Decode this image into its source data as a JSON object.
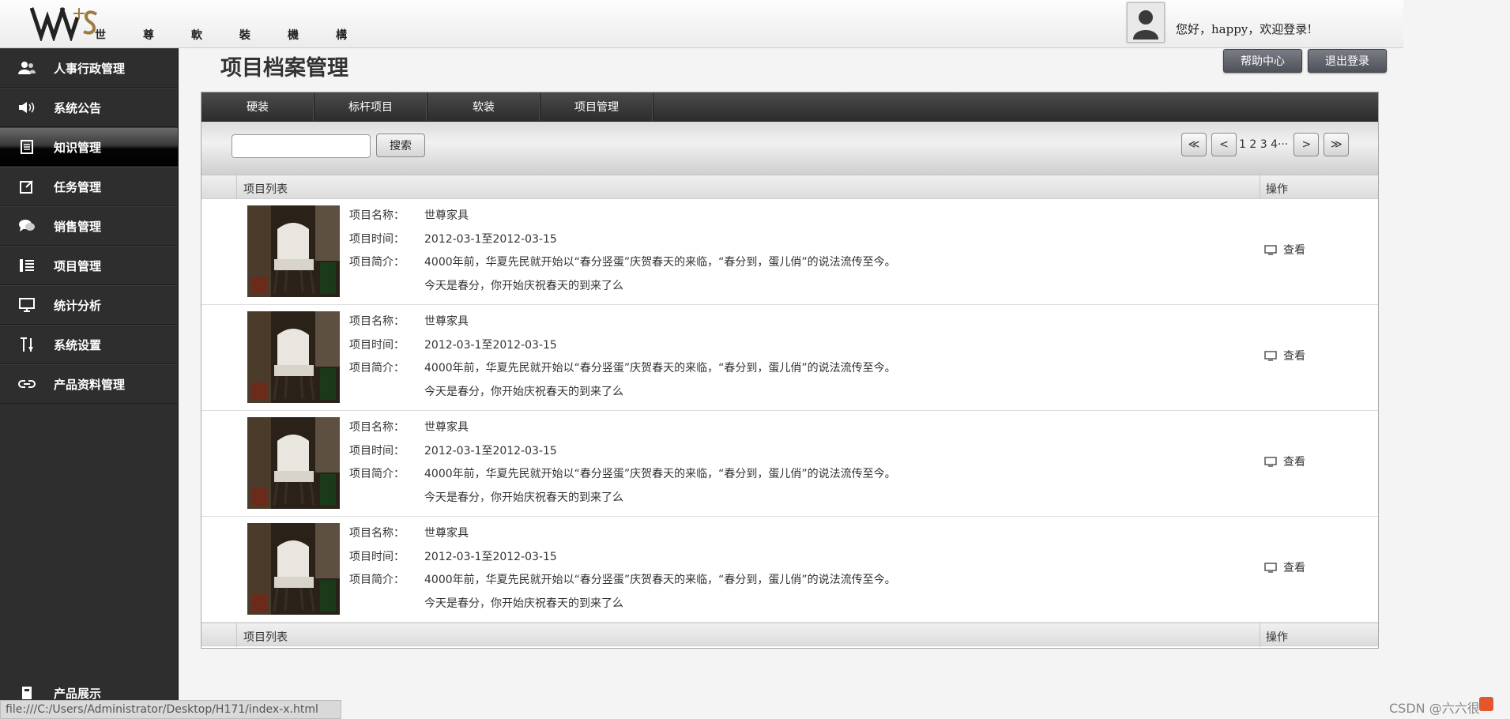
{
  "header": {
    "logo_chars": [
      "世",
      "尊",
      "軟",
      "裝",
      "機",
      "構"
    ],
    "greeting": "您好，happy，欢迎登录!"
  },
  "sidebar": {
    "items": [
      {
        "label": "人事行政管理",
        "icon": "users-icon"
      },
      {
        "label": "系统公告",
        "icon": "speaker-icon"
      },
      {
        "label": "知识管理",
        "icon": "document-icon",
        "active": true
      },
      {
        "label": "任务管理",
        "icon": "edit-icon"
      },
      {
        "label": "销售管理",
        "icon": "chat-icon"
      },
      {
        "label": "项目管理",
        "icon": "list-icon"
      },
      {
        "label": "统计分析",
        "icon": "monitor-icon"
      },
      {
        "label": "系统设置",
        "icon": "tools-icon"
      },
      {
        "label": "产品资料管理",
        "icon": "link-icon"
      }
    ],
    "bottom_item": {
      "label": "产品展示",
      "icon": "book-icon"
    }
  },
  "main": {
    "title": "项目档案管理",
    "help_label": "帮助中心",
    "logout_label": "退出登录",
    "tabs": [
      "硬装",
      "标杆项目",
      "软装",
      "项目管理"
    ],
    "search_label": "搜索",
    "search_value": "",
    "pager": {
      "first": "≪",
      "prev": "<",
      "pages": "1 2 3 4···",
      "ellipsis": "···",
      "next": ">",
      "last": "≫"
    },
    "list_header": {
      "col1": "项目列表",
      "col2": "操作"
    },
    "rows": [
      {
        "name_label": "项目名称：",
        "name": "世尊家具",
        "time_label": "项目时间：",
        "time": "2012-03-1至2012-03-15",
        "intro_label": "项目简介：",
        "intro1": "4000年前，华夏先民就开始以“春分竖蛋”庆贺春天的来临，“春分到，蛋儿俏”的说法流传至今。",
        "intro2": "今天是春分，你开始庆祝春天的到来了么",
        "action": "查看"
      },
      {
        "name_label": "项目名称：",
        "name": "世尊家具",
        "time_label": "项目时间：",
        "time": "2012-03-1至2012-03-15",
        "intro_label": "项目简介：",
        "intro1": "4000年前，华夏先民就开始以“春分竖蛋”庆贺春天的来临，“春分到，蛋儿俏”的说法流传至今。",
        "intro2": "今天是春分，你开始庆祝春天的到来了么",
        "action": "查看"
      },
      {
        "name_label": "项目名称：",
        "name": "世尊家具",
        "time_label": "项目时间：",
        "time": "2012-03-1至2012-03-15",
        "intro_label": "项目简介：",
        "intro1": "4000年前，华夏先民就开始以“春分竖蛋”庆贺春天的来临，“春分到，蛋儿俏”的说法流传至今。",
        "intro2": "今天是春分，你开始庆祝春天的到来了么",
        "action": "查看"
      },
      {
        "name_label": "项目名称：",
        "name": "世尊家具",
        "time_label": "项目时间：",
        "time": "2012-03-1至2012-03-15",
        "intro_label": "项目简介：",
        "intro1": "4000年前，华夏先民就开始以“春分竖蛋”庆贺春天的来临，“春分到，蛋儿俏”的说法流传至今。",
        "intro2": "今天是春分，你开始庆祝春天的到来了么",
        "action": "查看"
      }
    ]
  },
  "statusbar": {
    "url": "file:///C:/Users/Administrator/Desktop/H171/index-x.html"
  },
  "watermark": "CSDN @六六很",
  "colors": {
    "sidebar_bg": "#2e2e2e",
    "tab_bar": "#333333",
    "button": "#5b5e66"
  }
}
